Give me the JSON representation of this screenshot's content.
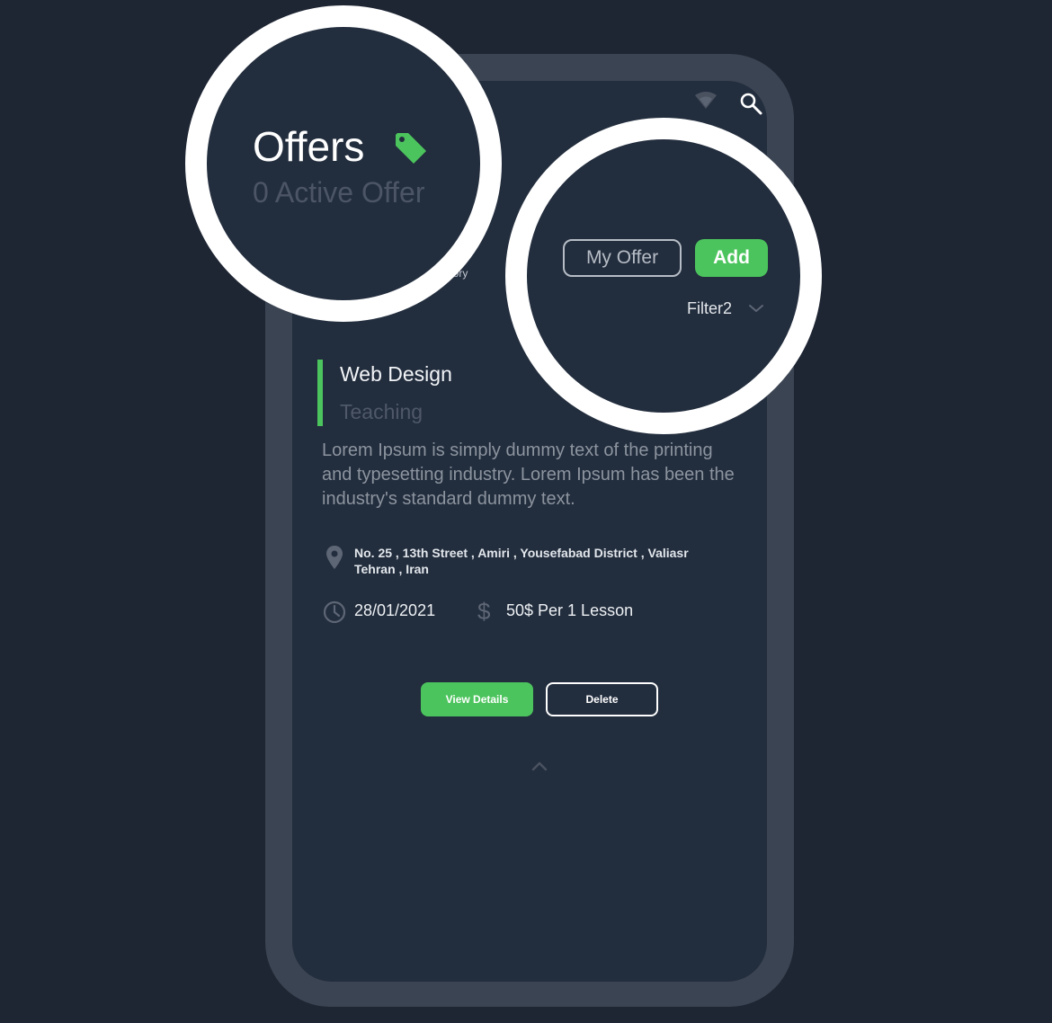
{
  "header": {
    "title": "Offers",
    "subtitle": "0 Active Offer",
    "partial_label": "gory"
  },
  "actions": {
    "my_offer_label": "My Offer",
    "add_label": "Add",
    "filter_label": "Filter2"
  },
  "offer_card": {
    "title": "Web Design",
    "category": "Teaching",
    "description": "Lorem Ipsum is simply dummy text of the printing and typesetting industry. Lorem Ipsum has been the industry's standard dummy text.",
    "address_line1": "No. 25 , 13th Street , Amiri , Yousefabad District , Valiasr",
    "address_line2": "Tehran , Iran",
    "date": "28/01/2021",
    "price": "50$ Per 1 Lesson",
    "view_details_label": "View Details",
    "delete_label": "Delete"
  },
  "icons": {
    "status": [
      "wifi-icon",
      "search-icon"
    ],
    "title_icon": "tag-icon",
    "card": [
      "location-icon",
      "clock-icon",
      "dollar-icon"
    ],
    "filter": "chevron-down-icon",
    "footer": "chevron-up-icon"
  },
  "colors": {
    "background": "#1e2533",
    "screen": "#222d3d",
    "phone_frame": "#3b4452",
    "accent": "#4cc45d",
    "text_primary": "#ffffff",
    "text_muted": "#4b5566"
  }
}
